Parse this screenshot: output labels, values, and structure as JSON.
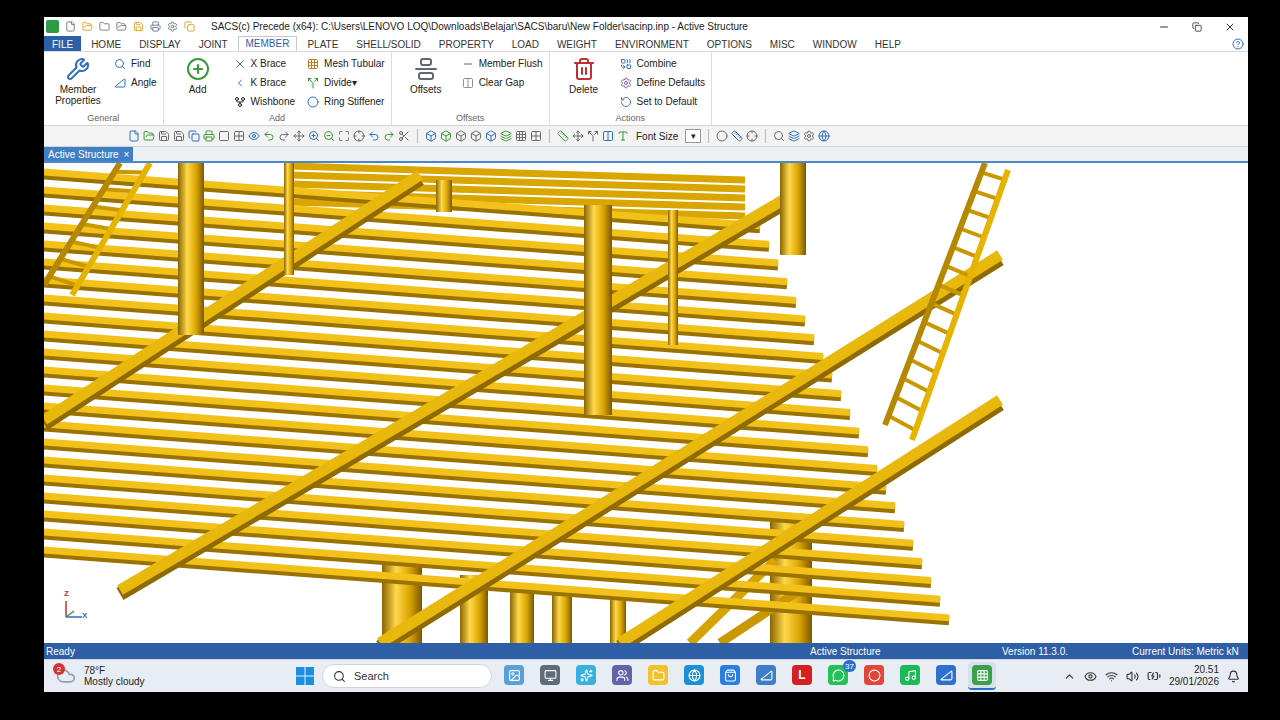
{
  "window": {
    "title": "SACS(c) Precede (x64):  C:\\Users\\LENOVO LOQ\\Downloads\\Belajar\\SACS\\baru\\New Folder\\sacinp.inp - Active Structure"
  },
  "menu_tabs": [
    {
      "label": "FILE",
      "kind": "file",
      "selected": false
    },
    {
      "label": "HOME",
      "kind": "tab",
      "selected": false
    },
    {
      "label": "DISPLAY",
      "kind": "tab",
      "selected": false
    },
    {
      "label": "JOINT",
      "kind": "tab",
      "selected": false
    },
    {
      "label": "MEMBER",
      "kind": "tab",
      "selected": true
    },
    {
      "label": "PLATE",
      "kind": "tab",
      "selected": false
    },
    {
      "label": "SHELL/SOLID",
      "kind": "tab",
      "selected": false
    },
    {
      "label": "PROPERTY",
      "kind": "tab",
      "selected": false
    },
    {
      "label": "LOAD",
      "kind": "tab",
      "selected": false
    },
    {
      "label": "WEIGHT",
      "kind": "tab",
      "selected": false
    },
    {
      "label": "ENVIRONMENT",
      "kind": "tab",
      "selected": false
    },
    {
      "label": "OPTIONS",
      "kind": "tab",
      "selected": false
    },
    {
      "label": "MISC",
      "kind": "tab",
      "selected": false
    },
    {
      "label": "WINDOW",
      "kind": "tab",
      "selected": false
    },
    {
      "label": "HELP",
      "kind": "tab",
      "selected": false
    }
  ],
  "ribbon_groups": [
    {
      "title": "General",
      "items": [
        {
          "label": "Member Properties",
          "kind": "large"
        },
        {
          "label": "Find",
          "kind": "small"
        },
        {
          "label": "Angle",
          "kind": "small"
        }
      ]
    },
    {
      "title": "Add",
      "items": [
        {
          "label": "Add",
          "kind": "large"
        },
        {
          "label": "X Brace",
          "kind": "small"
        },
        {
          "label": "K Brace",
          "kind": "small"
        },
        {
          "label": "Wishbone",
          "kind": "small"
        },
        {
          "label": "Mesh Tubular",
          "kind": "small"
        },
        {
          "label": "Divide",
          "kind": "small",
          "arrow": "▾"
        },
        {
          "label": "Ring Stiffener",
          "kind": "small"
        }
      ]
    },
    {
      "title": "Offsets",
      "items": [
        {
          "label": "Offsets",
          "kind": "large"
        },
        {
          "label": "Member Flush",
          "kind": "small"
        },
        {
          "label": "Clear Gap",
          "kind": "small"
        }
      ]
    },
    {
      "title": "Actions",
      "items": [
        {
          "label": "Delete",
          "kind": "large"
        },
        {
          "label": "Combine",
          "kind": "small"
        },
        {
          "label": "Define Defaults",
          "kind": "small"
        },
        {
          "label": "Set to Default",
          "kind": "small"
        }
      ]
    }
  ],
  "toolbar": {
    "font_size": {
      "label": "Font Size",
      "arrow": "▾"
    }
  },
  "document_tabs": [
    {
      "label": "Active Structure",
      "close": "×",
      "selected": true
    }
  ],
  "viewport": {
    "axes": {
      "z": "Z",
      "x": "X"
    }
  },
  "status_bar": {
    "left": "Ready",
    "center": "Active Structure",
    "version": "Version 11.3.0.",
    "units": "Current Units: Metric kN"
  },
  "taskbar": {
    "weather": {
      "badge": "2",
      "temp": "78°F",
      "condition": "Mostly cloudy"
    },
    "search": "Search",
    "apps": [
      {
        "name": "widgets",
        "color": "#5aa0d8",
        "badge": "",
        "glyph": "",
        "selected": false
      },
      {
        "name": "task-view",
        "color": "#5f6b78",
        "badge": "",
        "glyph": "",
        "selected": false
      },
      {
        "name": "copilot",
        "color": "#3ab0e0",
        "badge": "",
        "glyph": "",
        "selected": false
      },
      {
        "name": "teams",
        "color": "#6264a7",
        "badge": "",
        "glyph": "",
        "selected": false
      },
      {
        "name": "file-explorer",
        "color": "#f2c12e",
        "badge": "",
        "glyph": "",
        "selected": false
      },
      {
        "name": "edge",
        "color": "#1d8fd6",
        "badge": "",
        "glyph": "",
        "selected": false
      },
      {
        "name": "store",
        "color": "#2a7de1",
        "badge": "",
        "glyph": "",
        "selected": false
      },
      {
        "name": "app-a",
        "color": "#3c7fc8",
        "badge": "",
        "glyph": "",
        "selected": false
      },
      {
        "name": "app-l",
        "color": "#d42020",
        "badge": "",
        "glyph": "L",
        "selected": false
      },
      {
        "name": "whatsapp",
        "color": "#25c05a",
        "badge": "37",
        "glyph": "",
        "selected": false
      },
      {
        "name": "chrome",
        "color": "#e2463a",
        "badge": "",
        "glyph": "",
        "selected": false
      },
      {
        "name": "spotify",
        "color": "#1db954",
        "badge": "",
        "glyph": "",
        "selected": false
      },
      {
        "name": "app-b",
        "color": "#2f6fd0",
        "badge": "",
        "glyph": "",
        "selected": false
      },
      {
        "name": "sacs",
        "color": "#3aa04a",
        "badge": "",
        "glyph": "",
        "selected": true
      }
    ],
    "time": "20.51",
    "date": "29/01/2026"
  }
}
